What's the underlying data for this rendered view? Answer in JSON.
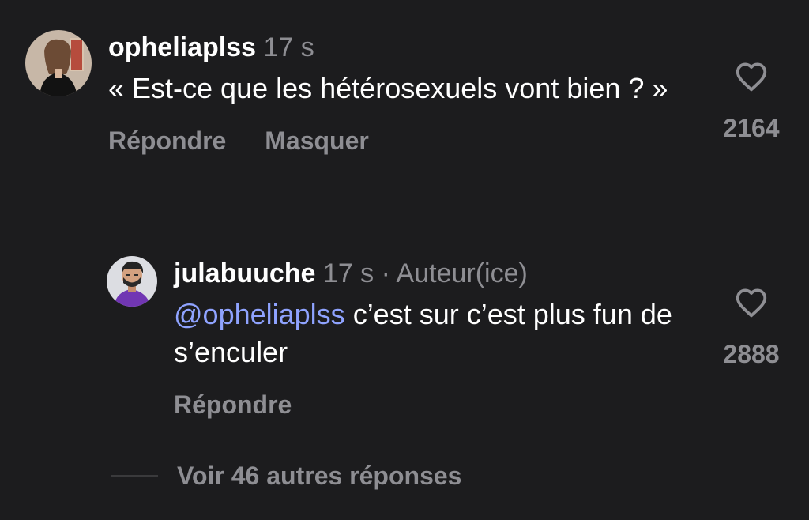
{
  "comments": [
    {
      "username": "opheliaplss",
      "time": "17 s",
      "text": "« Est-ce que les hétérosexuels vont bien ? »",
      "likes": "2164",
      "actions": {
        "reply": "Répondre",
        "hide": "Masquer"
      },
      "heart_icon": "heart-outline-icon"
    }
  ],
  "replies": [
    {
      "username": "julabuuche",
      "time": "17 s",
      "separator": "·",
      "author_tag": "Auteur(ice)",
      "mention": "@opheliaplss",
      "text": "c’est sur c’est plus fun de s’enculer",
      "likes": "2888",
      "actions": {
        "reply": "Répondre"
      },
      "heart_icon": "heart-outline-icon"
    }
  ],
  "view_more": {
    "label": "Voir 46 autres réponses"
  },
  "colors": {
    "background": "#1c1c1e",
    "text": "#ffffff",
    "muted": "#8e8e93",
    "mention": "#8fa3ff"
  }
}
